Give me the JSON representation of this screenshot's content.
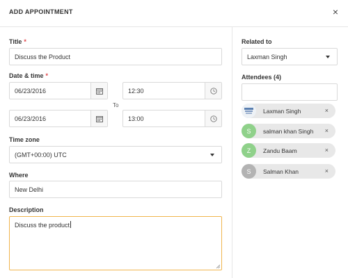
{
  "dialog": {
    "title": "ADD APPOINTMENT",
    "close_symbol": "×"
  },
  "form": {
    "title": {
      "label": "Title",
      "required_mark": "*",
      "value": "Discuss the Product"
    },
    "datetime": {
      "label": "Date & time",
      "required_mark": "*",
      "start_date": "06/23/2016",
      "start_time": "12:30",
      "to_label": "To",
      "end_date": "06/23/2016",
      "end_time": "13:00"
    },
    "timezone": {
      "label": "Time zone",
      "value": "(GMT+00:00) UTC"
    },
    "where": {
      "label": "Where",
      "value": "New Delhi"
    },
    "description": {
      "label": "Description",
      "value": "Discuss the product"
    }
  },
  "sidebar": {
    "related_to": {
      "label": "Related to",
      "value": "Laxman Singh"
    },
    "attendees": {
      "label": "Attendees (4)",
      "search_value": "",
      "items": [
        {
          "name": "Laxman Singh",
          "avatar_type": "image",
          "avatar_letter": "",
          "avatar_color": "#dfe6ee"
        },
        {
          "name": "salman khan Singh",
          "avatar_type": "letter",
          "avatar_letter": "S",
          "avatar_color": "#8fd18a"
        },
        {
          "name": "Zandu Baam",
          "avatar_type": "letter",
          "avatar_letter": "Z",
          "avatar_color": "#8fd18a"
        },
        {
          "name": "Salman Khan",
          "avatar_type": "letter",
          "avatar_letter": "S",
          "avatar_color": "#b3b3b3"
        }
      ],
      "remove_symbol": "×"
    }
  },
  "icons": {
    "calendar": "calendar-icon",
    "clock": "clock-icon",
    "dropdown": "chevron-down-icon",
    "close": "close-icon",
    "resize": "resize-grip-icon"
  },
  "colors": {
    "required": "#e0454a",
    "focus_border": "#f0b44c",
    "chip_bg": "#e8e8e8",
    "avatar_green": "#8fd18a",
    "avatar_gray": "#b3b3b3"
  }
}
